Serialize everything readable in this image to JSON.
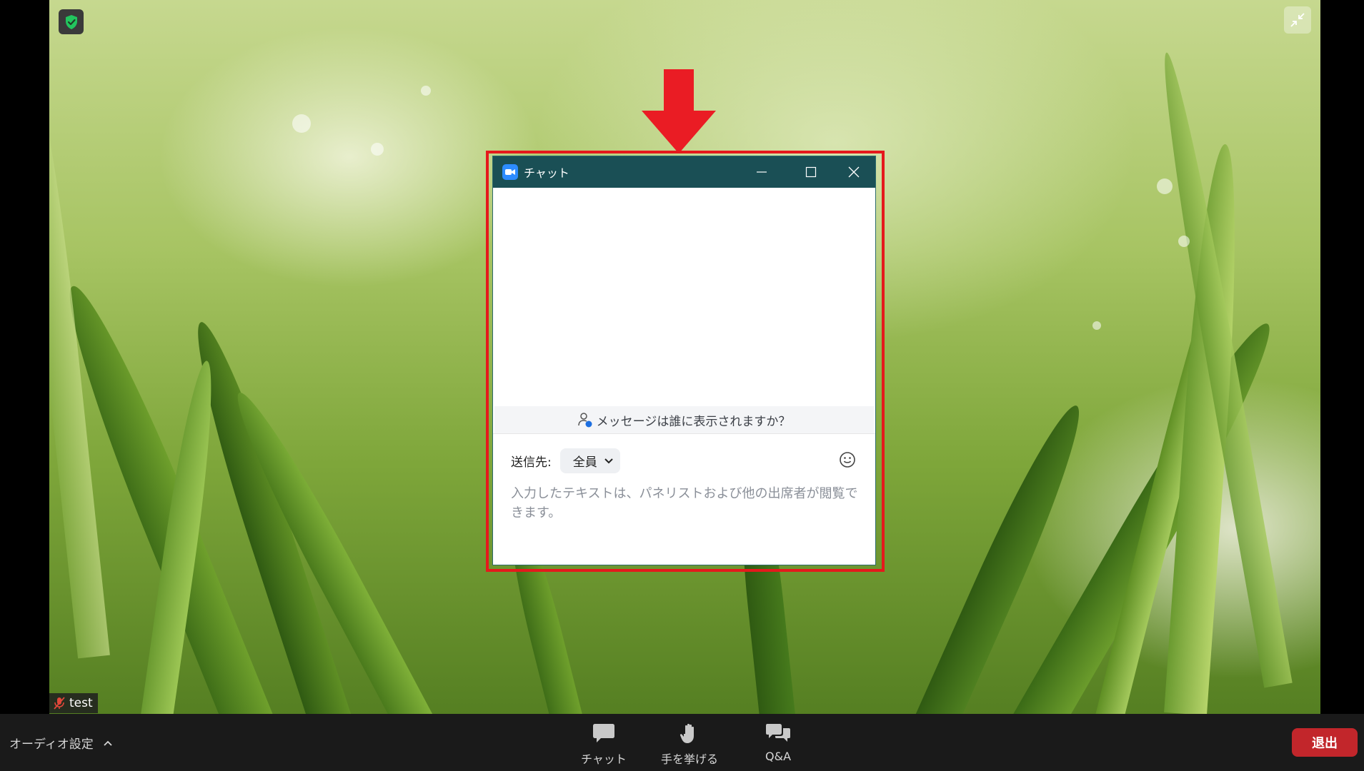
{
  "colors": {
    "titlebar": "#1a4f55",
    "highlight": "#e5191c",
    "arrow": "#ea1c24",
    "leave_button": "#c2262b",
    "toolbar": "#1a1a1a"
  },
  "video": {
    "participant_name": "test",
    "icons": [
      "shield-check-icon",
      "collapse-icon",
      "mic-muted-icon"
    ]
  },
  "chat_window": {
    "title": "チャット",
    "who_sees": "メッセージは誰に表示されますか？",
    "to_label": "送信先:",
    "to_value": "全員",
    "input_placeholder": "入力したテキストは、パネリストおよび他の出席者が閲覧できます。"
  },
  "toolbar": {
    "audio_settings": "オーディオ設定",
    "chat": "チャット",
    "raise_hand": "手を挙げる",
    "qa": "Q&A",
    "leave": "退出"
  }
}
